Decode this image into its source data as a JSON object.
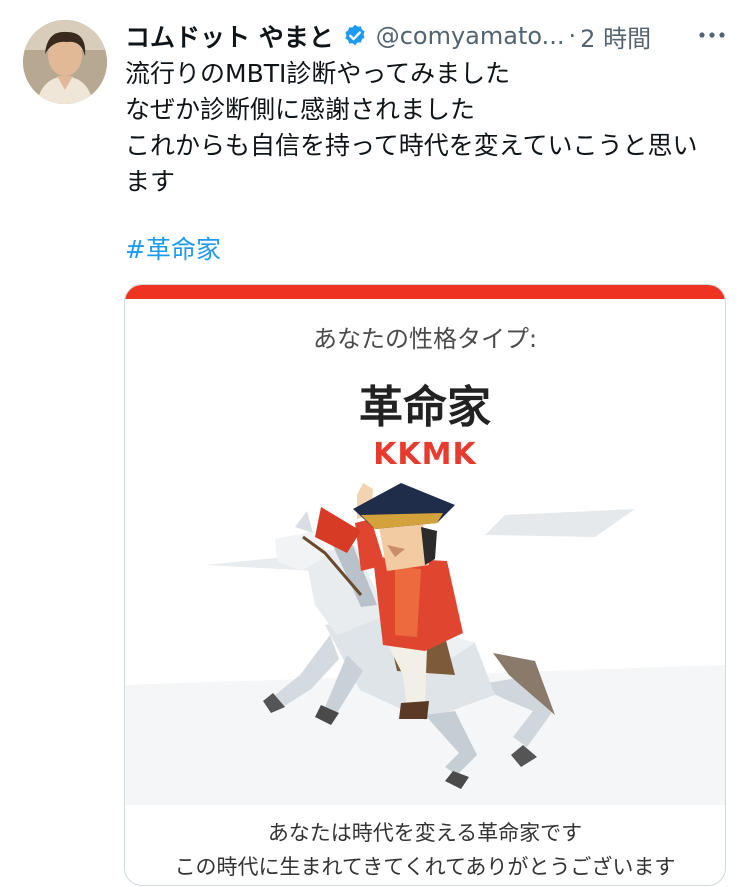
{
  "tweet": {
    "display_name": "コムドット やまと",
    "handle": "@comyamato...",
    "separator": "·",
    "time": "2 時間",
    "lines": [
      "流行りのMBTI診断やってみました",
      "なぜか診断側に感謝されました",
      "これからも自信を持って時代を変えていこうと思い",
      "ます"
    ],
    "hashtag": "#革命家"
  },
  "media": {
    "label": "あなたの性格タイプ:",
    "type_name": "革命家",
    "code": "KKMK",
    "description_1": "あなたは時代を変える革命家です",
    "description_2": "この時代に生まれてきてくれてありがとうございます"
  },
  "colors": {
    "accent": "#ee3420",
    "link": "#1d9bf0",
    "verified": "#1d9bf0",
    "code": "#e63b2e"
  },
  "icons": {
    "verified": "verified-badge-icon",
    "more": "more-horizontal-icon"
  }
}
